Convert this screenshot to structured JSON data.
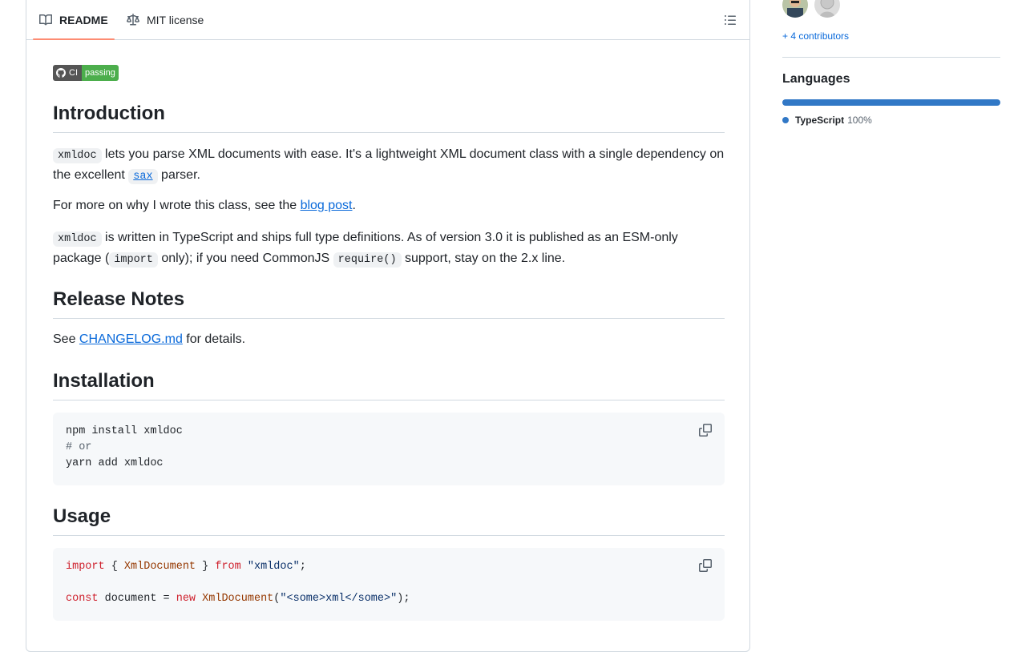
{
  "tabs": [
    {
      "label": "README"
    },
    {
      "label": "MIT license"
    }
  ],
  "badge": {
    "left": "CI",
    "right": "passing"
  },
  "sections": {
    "intro": {
      "heading": "Introduction",
      "p1": {
        "code1": "xmldoc",
        "text1": " lets you parse XML documents with ease. It's a lightweight XML document class with a single dependency on the excellent ",
        "link_code": "sax",
        "text2": " parser."
      },
      "p2": {
        "text1": "For more on why I wrote this class, see the ",
        "link": "blog post",
        "text2": "."
      },
      "p3": {
        "code1": "xmldoc",
        "text1": " is written in TypeScript and ships full type definitions. As of version 3.0 it is published as an ESM-only package (",
        "code2": "import",
        "text2": " only); if you need CommonJS ",
        "code3": "require()",
        "text3": " support, stay on the 2.x line."
      }
    },
    "release": {
      "heading": "Release Notes",
      "p": {
        "text1": "See ",
        "link": "CHANGELOG.md",
        "text2": " for details."
      }
    },
    "install": {
      "heading": "Installation",
      "lines": [
        "npm install xmldoc",
        "# or",
        "yarn add xmldoc"
      ]
    },
    "usage": {
      "heading": "Usage",
      "line1": {
        "kw": "import",
        "p1": " { ",
        "cls": "XmlDocument",
        "p2": " } ",
        "kw2": "from",
        "sp": " ",
        "str": "\"xmldoc\"",
        "end": ";"
      },
      "line2": {
        "kw": "const",
        "p1": " document = ",
        "kw2": "new",
        "sp": " ",
        "cls": "XmlDocument",
        "p2": "(",
        "str": "\"<some>xml</some>\"",
        "end": ");"
      }
    }
  },
  "sidebar": {
    "contributors_link": "+ 4 contributors",
    "languages_heading": "Languages",
    "languages": [
      {
        "name": "TypeScript",
        "percent": "100%",
        "color": "#3178c6"
      }
    ]
  },
  "colors": {
    "accent": "#0969da",
    "tab_underline": "#fd8c73",
    "typescript": "#3178c6"
  }
}
